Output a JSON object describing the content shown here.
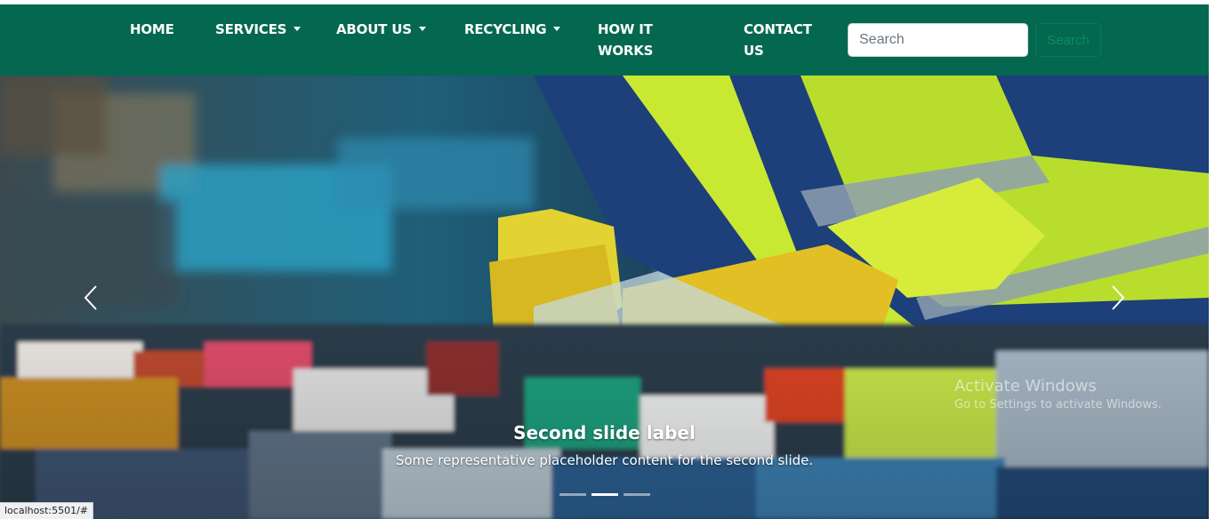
{
  "nav": {
    "items": [
      {
        "label": "HOME",
        "dropdown": false
      },
      {
        "label": "SERVICES",
        "dropdown": true
      },
      {
        "label": "ABOUT US",
        "dropdown": true
      },
      {
        "label": "RECYCLING",
        "dropdown": true
      },
      {
        "label_line1": "HOW IT",
        "label_line2": "WORKS",
        "dropdown": false
      },
      {
        "label_line1": "CONTACT",
        "label_line2": "US",
        "dropdown": false
      }
    ],
    "search": {
      "placeholder": "Search",
      "value": "",
      "button_label": "Search"
    }
  },
  "carousel": {
    "caption_title": "Second slide label",
    "caption_text": "Some representative placeholder content for the second slide.",
    "indicator_count": 3,
    "active_index": 1,
    "prev_icon": "chevron-left-icon",
    "next_icon": "chevron-right-icon"
  },
  "watermark": {
    "line1": "Activate Windows",
    "line2": "Go to Settings to activate Windows."
  },
  "status_bar": {
    "url": "localhost:5501/#"
  },
  "colors": {
    "navbar_bg": "#03684f",
    "nav_text": "#ffffff",
    "search_button_text": "#0f8a5c"
  }
}
